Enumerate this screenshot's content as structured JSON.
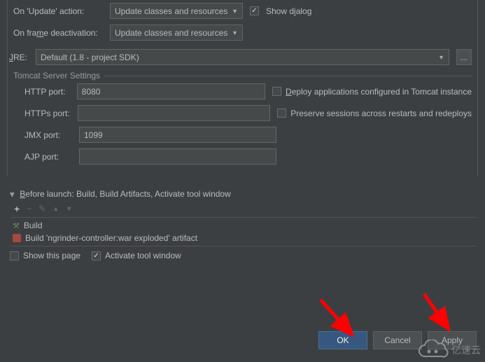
{
  "topSection": {
    "onUpdateLabel": "On 'Update' action:",
    "onUpdateValue": "Update classes and resources",
    "showDialog": "Show dialog",
    "onFrameLabel": "On frame deactivation:",
    "onFrameValue": "Update classes and resources",
    "jreLabel": "JRE:",
    "jreValue": "Default (1.8 - project SDK)",
    "ellipsis": "..."
  },
  "tomcat": {
    "title": "Tomcat Server Settings",
    "httpLabel": "HTTP port:",
    "httpValue": "8080",
    "httpsLabel": "HTTPs port:",
    "httpsValue": "",
    "jmxLabel": "JMX port:",
    "jmxValue": "1099",
    "ajpLabel": "AJP port:",
    "ajpValue": "",
    "deployLabel": "Deploy applications configured in Tomcat instance",
    "preserveLabel": "Preserve sessions across restarts and redeploys"
  },
  "beforeLaunch": {
    "header": "Before launch: Build, Build Artifacts, Activate tool window",
    "task1": "Build",
    "task2": "Build 'ngrinder-controller:war exploded' artifact",
    "showPage": "Show this page",
    "activate": "Activate tool window",
    "check": "✓"
  },
  "buttons": {
    "ok": "OK",
    "cancel": "Cancel",
    "apply": "Apply"
  },
  "watermark": "亿速云"
}
